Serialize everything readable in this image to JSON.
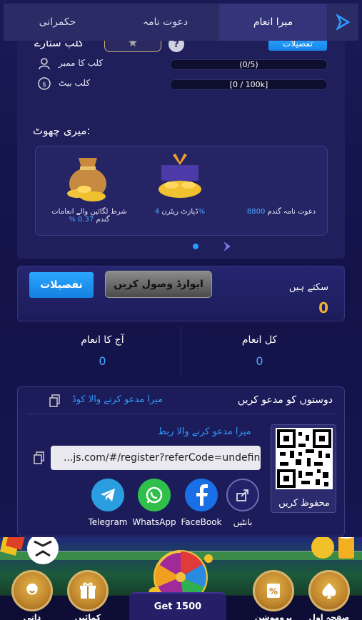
{
  "tabs": {
    "my_reward": "میرا انعام",
    "invite": "دعوت نامہ",
    "ruling": "حکمرانی"
  },
  "club": {
    "star_label": "کلب ستارے",
    "details_label": "تفصیلات",
    "member_label": "کلب کا ممبر",
    "member_progress": "(0/5)",
    "bet_label": "کلب بیٹ",
    "bet_progress": "[0 / 100k]"
  },
  "discount": {
    "title": ":میری چھوٹ",
    "items": [
      {
        "label": "شرط لگائیں والے انعامات",
        "value": "% 0.37",
        "suffix": "گندم"
      },
      {
        "label": "ڈپازٹ ریٹرن",
        "value": "4%"
      },
      {
        "label": "دعوت نامہ گندم",
        "value": "8800"
      }
    ]
  },
  "reward": {
    "details_label": "تفصیلات",
    "claim_label": "ایوارڈ وصول کریں",
    "can_label": "سکتے ہیں",
    "can_value": "0"
  },
  "totals": {
    "today_label": "آج کا انعام",
    "today_value": "0",
    "total_label": "کل انعام",
    "total_value": "0"
  },
  "invite": {
    "title": "دوستوں کو مدعو کریں",
    "code_label": "میرا مدعو کرنے والا کوڈ",
    "link_label": "میرا مدعو کرنے والا ربط",
    "link_value": "...js.com/#/register?referCode=undefined",
    "qr_save": "محفوظ کریں",
    "share": {
      "telegram": "Telegram",
      "whatsapp": "WhatsApp",
      "facebook": "FaceBook",
      "share": "بانٹیں"
    }
  },
  "nav": {
    "home": "صفحہ اول",
    "promotion": "پروموشن",
    "earn": "کمائیں",
    "mine": "ذاتی",
    "get_label": "Get 1500"
  },
  "colors": {
    "accent_blue": "#2e9bff",
    "gold": "#f0b030",
    "background": "#14144a"
  }
}
